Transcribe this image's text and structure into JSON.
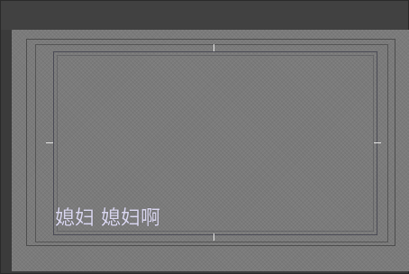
{
  "preview": {
    "subtitle_text": "媳妇 媳妇啊"
  },
  "colors": {
    "window_bg": "#3b3b3b",
    "canvas_bg": "#7b7b7b",
    "frame": "#4a4a55",
    "subtitle": "#d9d6ef",
    "guide_tick": "#e6e6e6"
  }
}
